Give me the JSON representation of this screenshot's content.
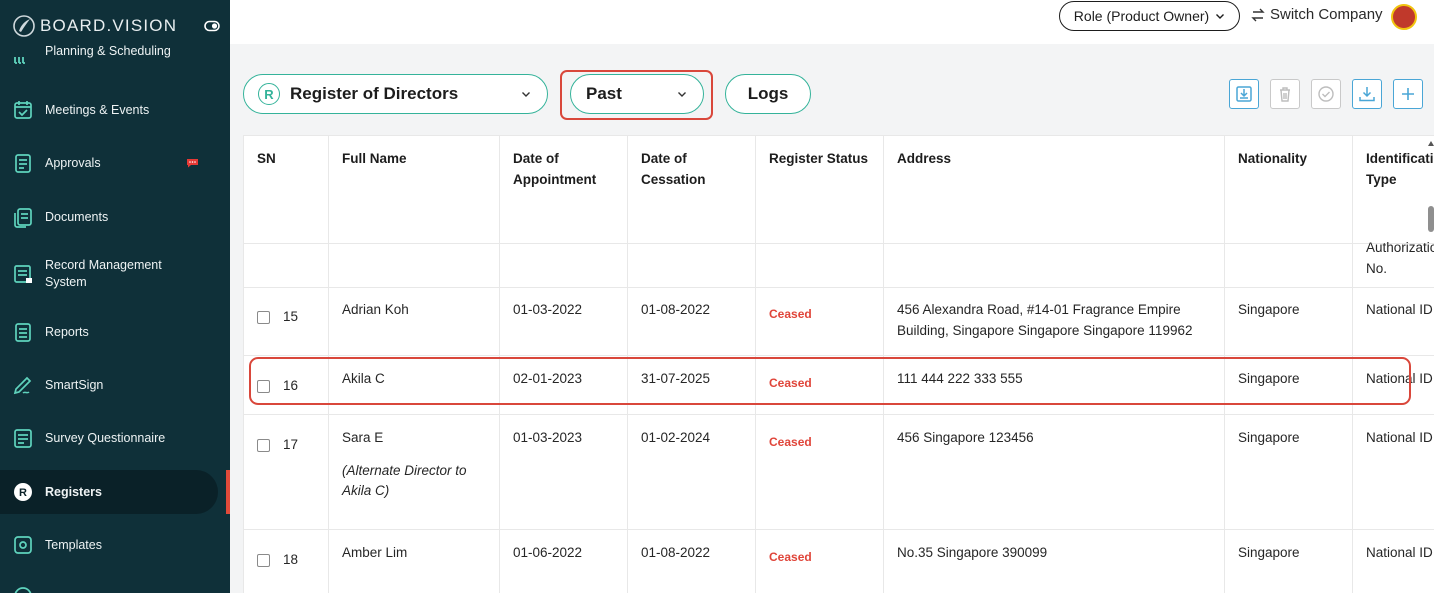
{
  "brand": {
    "name": "BOARD.VISION"
  },
  "sidebar": {
    "items": [
      {
        "label": "Planning & Scheduling",
        "icon": "calendar-grid-icon"
      },
      {
        "label": "Meetings & Events",
        "icon": "calendar-check-icon"
      },
      {
        "label": "Approvals",
        "icon": "approvals-icon",
        "badge": "chat-badge-icon"
      },
      {
        "label": "Documents",
        "icon": "documents-icon"
      },
      {
        "label": "Record Management System",
        "icon": "record-icon"
      },
      {
        "label": "Reports",
        "icon": "reports-icon"
      },
      {
        "label": "SmartSign",
        "icon": "signature-icon"
      },
      {
        "label": "Survey Questionnaire",
        "icon": "survey-icon"
      },
      {
        "label": "Registers",
        "icon": "registers-icon",
        "active": true
      },
      {
        "label": "Templates",
        "icon": "templates-icon"
      }
    ]
  },
  "topbar": {
    "role": "Role (Product Owner)",
    "switch_company": "Switch Company"
  },
  "toolbar": {
    "register_select": {
      "badge": "R",
      "value": "Register of Directors"
    },
    "status_select": {
      "value": "Past"
    },
    "logs_label": "Logs"
  },
  "table": {
    "headers": {
      "sn": "SN",
      "full_name": "Full Name",
      "appointment": "Date of Appointment",
      "cessation": "Date of Cessation",
      "status": "Register Status",
      "address": "Address",
      "nationality": "Nationality",
      "id_type": "Identification Type"
    },
    "trailing_row": {
      "id_type": "Authorization No."
    },
    "rows": [
      {
        "sn": "15",
        "name": "Adrian Koh",
        "appointment": "01-03-2022",
        "cessation": "01-08-2022",
        "status": "Ceased",
        "address": "456 Alexandra Road, #14-01 Fragrance Empire Building, Singapore Singapore Singapore 119962",
        "nationality": "Singapore",
        "id_type": "National ID"
      },
      {
        "sn": "16",
        "name": "Akila C",
        "appointment": "02-01-2023",
        "cessation": "31-07-2025",
        "status": "Ceased",
        "address": "111 444 222 333 555",
        "nationality": "Singapore",
        "id_type": "National ID"
      },
      {
        "sn": "17",
        "name": "Sara E",
        "note": "(Alternate Director to Akila C)",
        "appointment": "01-03-2023",
        "cessation": "01-02-2024",
        "status": "Ceased",
        "address": "456 Singapore 123456",
        "nationality": "Singapore",
        "id_type": "National ID"
      },
      {
        "sn": "18",
        "name": "Amber Lim",
        "appointment": "01-06-2022",
        "cessation": "01-08-2022",
        "status": "Ceased",
        "address": "No.35 Singapore 390099",
        "nationality": "Singapore",
        "id_type": "National ID"
      }
    ]
  },
  "colors": {
    "sidebar_bg": "#0f3039",
    "accent_teal": "#34b39a",
    "status_ceased": "#e0453a",
    "highlight_red": "#d9473b",
    "tool_blue": "#4aa6d6"
  }
}
